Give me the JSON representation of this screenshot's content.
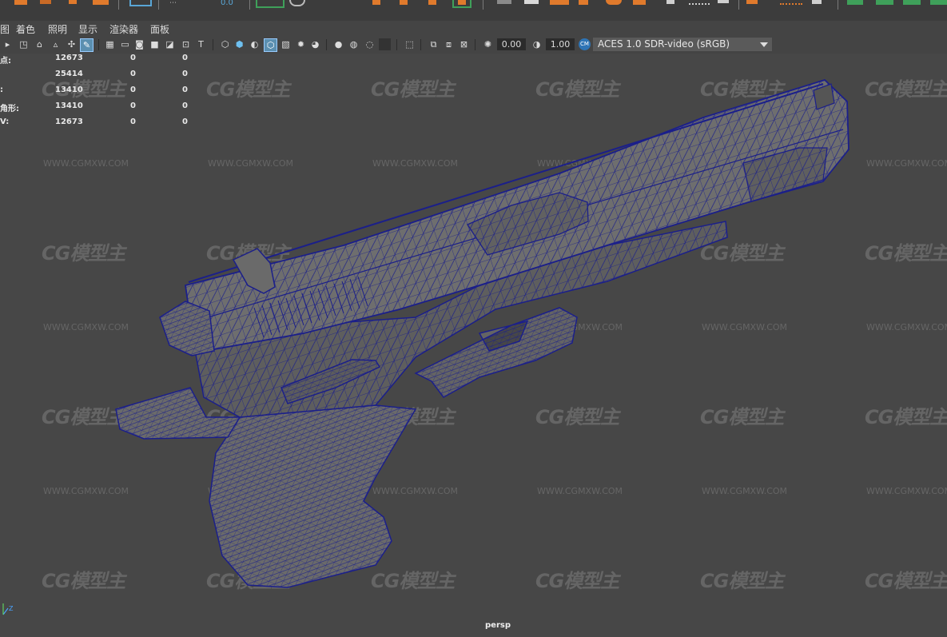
{
  "menu": {
    "items": [
      "图",
      "着色",
      "照明",
      "显示",
      "渲染器",
      "面板"
    ]
  },
  "toolbar": {
    "exposure_value": "0.00",
    "gamma_value": "1.00",
    "color_space": "ACES 1.0 SDR-video (sRGB)"
  },
  "shelf": {
    "snap_readout": "0.0"
  },
  "hud": {
    "rows": [
      {
        "label": "点:",
        "v1": "12673",
        "v2": "0",
        "v3": "0"
      },
      {
        "label": "",
        "v1": "25414",
        "v2": "0",
        "v3": "0"
      },
      {
        "label": ":",
        "v1": "13410",
        "v2": "0",
        "v3": "0"
      },
      {
        "label": "角形:",
        "v1": "13410",
        "v2": "0",
        "v3": "0"
      },
      {
        "label": "V:",
        "v1": "12673",
        "v2": "0",
        "v3": "0"
      }
    ]
  },
  "viewport": {
    "camera": "persp",
    "watermark_logo": "CG模型主",
    "watermark_url": "WWW.CGMXW.COM"
  },
  "axis": {
    "z": "Z"
  },
  "colors": {
    "wire": "#1b1f8a",
    "model_fill": "#6c6c6c",
    "viewport_bg": "#474747",
    "shelf_orange": "#e07a2c",
    "shelf_green": "#3fa05a"
  }
}
